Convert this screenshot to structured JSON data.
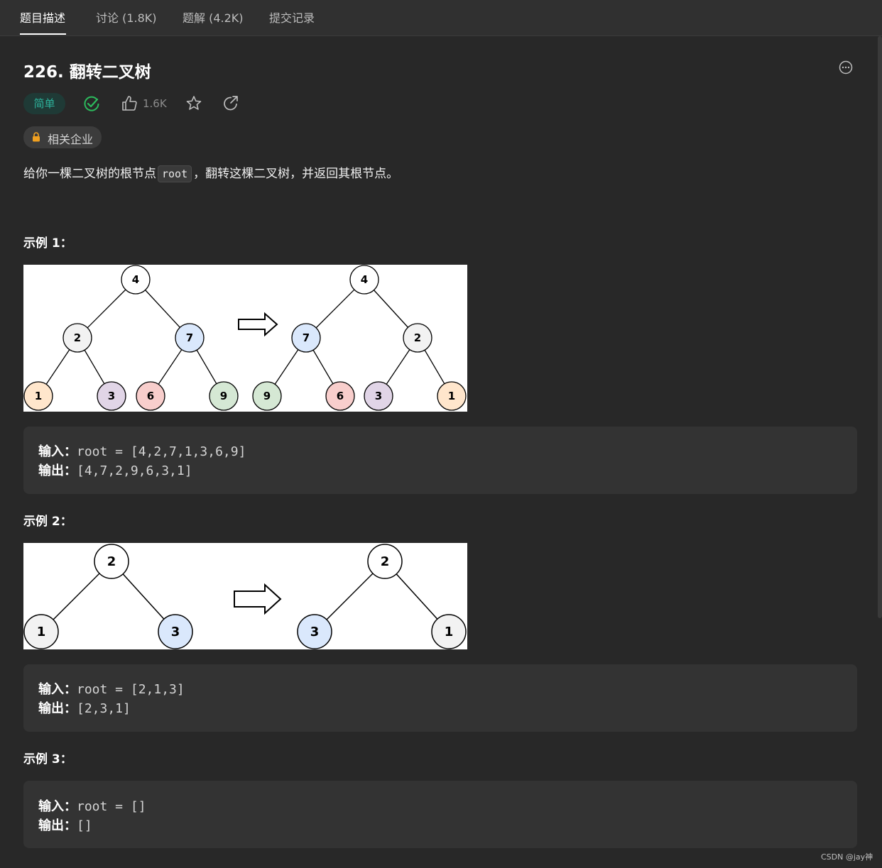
{
  "tabs": [
    {
      "label": "题目描述",
      "active": true
    },
    {
      "label": "讨论 (1.8K)",
      "active": false
    },
    {
      "label": "题解 (4.2K)",
      "active": false
    },
    {
      "label": "提交记录",
      "active": false
    }
  ],
  "problem": {
    "title": "226. 翻转二叉树",
    "difficulty": "简单",
    "likes": "1.6K",
    "companies_label": "相关企业",
    "description_before": "给你一棵二叉树的根节点",
    "description_code": "root",
    "description_after": "，翻转这棵二叉树，并返回其根节点。"
  },
  "examples": [
    {
      "title": "示例 1：",
      "input_label": "输入：",
      "input_value": "root = [4,2,7,1,3,6,9]",
      "output_label": "输出：",
      "output_value": "[4,7,2,9,6,3,1]",
      "tree_before": [
        "4",
        "2",
        "7",
        "1",
        "3",
        "6",
        "9"
      ],
      "tree_after": [
        "4",
        "7",
        "2",
        "9",
        "6",
        "3",
        "1"
      ]
    },
    {
      "title": "示例 2：",
      "input_label": "输入：",
      "input_value": "root = [2,1,3]",
      "output_label": "输出：",
      "output_value": "[2,3,1]",
      "tree_before": [
        "2",
        "1",
        "3"
      ],
      "tree_after": [
        "2",
        "3",
        "1"
      ]
    },
    {
      "title": "示例 3：",
      "input_label": "输入：",
      "input_value": "root = []",
      "output_label": "输出：",
      "output_value": "[]"
    }
  ],
  "colors": {
    "difficulty_easy": "#2db39c",
    "node_white": "#ffffff",
    "node_gray": "#f2f2f2",
    "node_blue": "#dae8fc",
    "node_orange": "#ffe6cc",
    "node_purple": "#e1d5e7",
    "node_red": "#f8cecc",
    "node_green": "#d5e8d4"
  },
  "icons": [
    "more-icon",
    "check-circle-icon",
    "thumbs-up-icon",
    "star-icon",
    "share-icon",
    "lock-icon"
  ],
  "watermark": "CSDN @jay神"
}
